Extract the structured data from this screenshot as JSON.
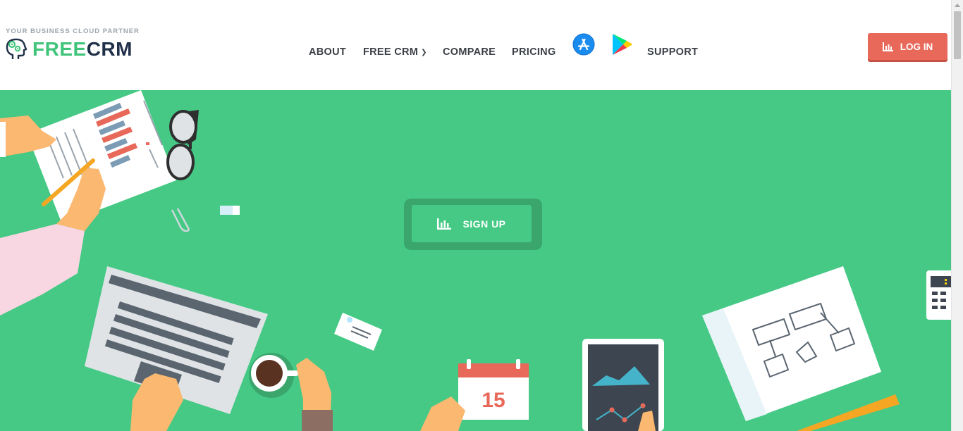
{
  "brand": {
    "tagline": "YOUR BUSINESS CLOUD PARTNER",
    "name_part1": "FREE",
    "name_part2": "CRM"
  },
  "nav": {
    "items": [
      {
        "label": "ABOUT"
      },
      {
        "label": "FREE CRM",
        "has_dropdown": true
      },
      {
        "label": "COMPARE"
      },
      {
        "label": "PRICING"
      },
      {
        "label": "SUPPORT"
      }
    ],
    "app_store_icon": "app-store-icon",
    "google_play_icon": "google-play-icon"
  },
  "login_button": {
    "label": "LOG IN",
    "icon": "bar-chart-icon"
  },
  "hero": {
    "signup_button": {
      "label": "SIGN UP",
      "icon": "bar-chart-icon"
    },
    "calendar_day": "15"
  },
  "colors": {
    "brand_green": "#45c985",
    "brand_dark": "#1f3048",
    "login_red": "#e8685a",
    "nav_text": "#3a3f45"
  }
}
